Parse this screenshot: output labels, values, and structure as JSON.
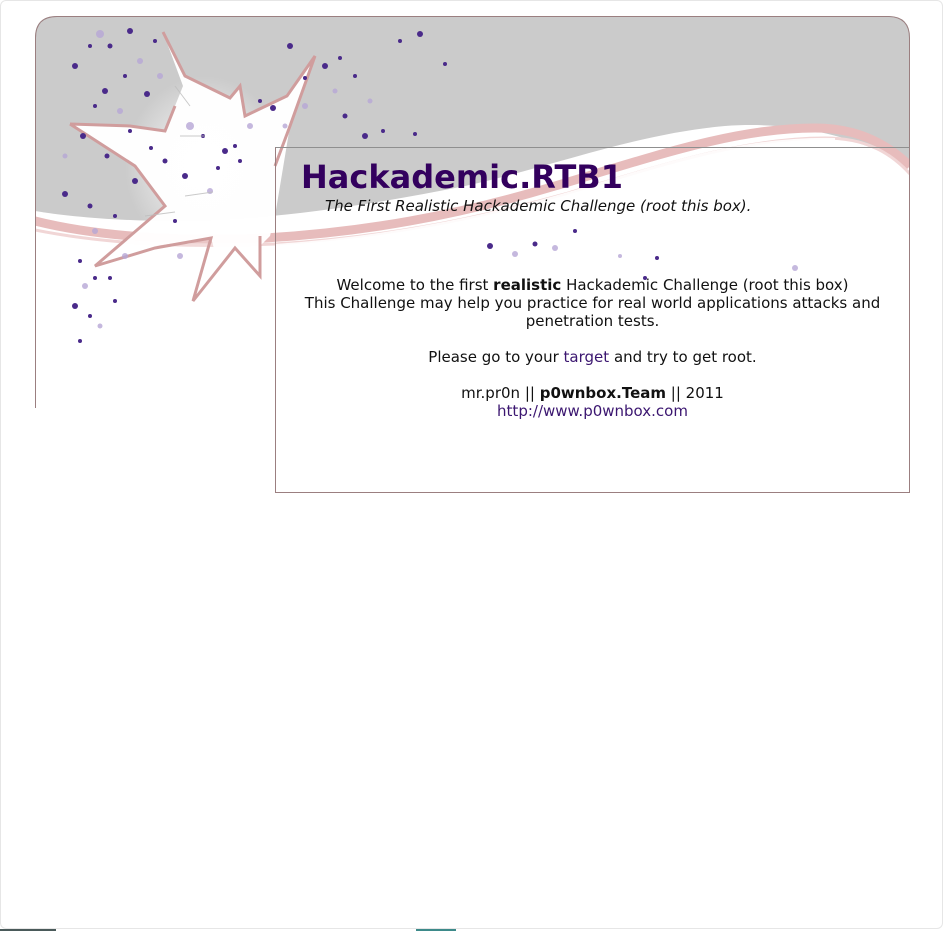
{
  "header": {
    "title": "Hackademic.RTB1",
    "subtitle": "The First Realistic Hackademic Challenge (root this box)."
  },
  "main": {
    "welcome_prefix": "Welcome to the first",
    "welcome_bold": "realistic",
    "welcome_suffix": "Hackademic Challenge (root this box)",
    "practice_line1": "This Challenge may help you practice for real world applications attacks and",
    "practice_line2": "penetration tests.",
    "goto_prefix": "Please go to your",
    "target_link": "target",
    "goto_suffix": "and try to get root.",
    "credit_author": "mr.pr0n ||",
    "credit_team": "p0wnbox.Team",
    "credit_year": "|| 2011",
    "site_link": "http://www.p0wnbox.com"
  },
  "colors": {
    "title": "#33005e",
    "link": "#3b1670",
    "banner_gray": "#cbcbcb",
    "accent_pink": "#d9a6a6",
    "border": "#9b7f80"
  }
}
